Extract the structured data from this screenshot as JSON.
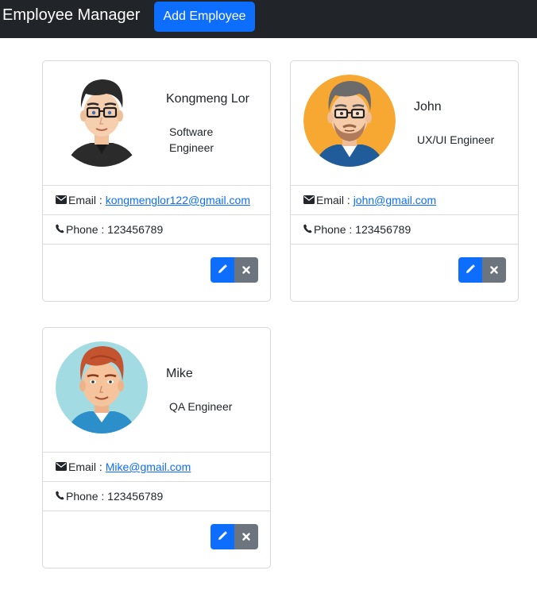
{
  "navbar": {
    "brand": "Employee Manager",
    "add_button_label": "Add Employee",
    "background": "#212529",
    "accent": "#0d6efd"
  },
  "employees": [
    {
      "name": "Kongmeng Lor",
      "title": "Software Engineer",
      "email_label": "Email : ",
      "email": "kongmenglor122@gmail.com",
      "phone_label": "Phone : ",
      "phone": "123456789",
      "avatar": "avatar-dark-hair-glasses"
    },
    {
      "name": "John",
      "title": "UX/UI Engineer",
      "email_label": "Email : ",
      "email": "john@gmail.com",
      "phone_label": "Phone : ",
      "phone": "123456789",
      "avatar": "avatar-grey-hair-glasses-orange-bg"
    },
    {
      "name": "Mike",
      "title": "QA Engineer",
      "email_label": "Email : ",
      "email": "Mike@gmail.com",
      "phone_label": "Phone : ",
      "phone": "123456789",
      "avatar": "avatar-red-hair-blue-bg"
    }
  ],
  "icons": {
    "email": "envelope-icon",
    "phone": "phone-icon",
    "edit": "pencil-icon",
    "delete": "close-icon"
  },
  "colors": {
    "edit_button": "#0d6efd",
    "delete_button": "#6c757d",
    "link": "#0d6efd"
  }
}
